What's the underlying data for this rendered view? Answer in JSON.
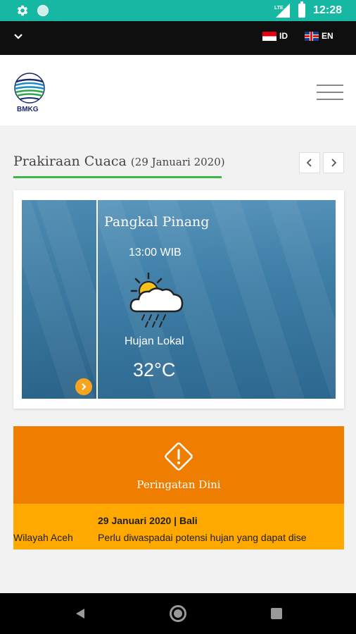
{
  "status_bar": {
    "time": "12:28",
    "network": "LTE"
  },
  "language_bar": {
    "options": [
      {
        "code": "ID"
      },
      {
        "code": "EN"
      }
    ]
  },
  "header": {
    "logo_text": "BMKG"
  },
  "forecast": {
    "title": "Prakiraan Cuaca",
    "date": "(29 Januari 2020)",
    "slide": {
      "city": "Pangkal Pinang",
      "time": "13:00 WIB",
      "condition": "Hujan Lokal",
      "temperature": "32°C",
      "icon": "partly-cloudy-rain-icon"
    }
  },
  "warning": {
    "title": "Peringatan Dini",
    "date_region": "29 Januari 2020 | Bali",
    "ticker_left": "Wilayah Aceh",
    "ticker_right": "Perlu diwaspadai potensi hujan yang dapat dise"
  },
  "colors": {
    "status_bar": "#16b8a3",
    "accent_green": "#3fb54a",
    "warning_orange": "#ef7d00",
    "warning_yellow": "#fea800"
  }
}
